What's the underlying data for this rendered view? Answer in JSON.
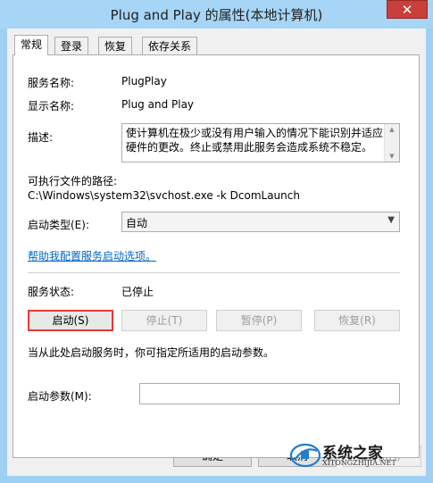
{
  "window": {
    "title": "Plug and Play 的属性(本地计算机)",
    "close_glyph": "✕"
  },
  "tabs": [
    {
      "label": "常规",
      "active": true
    },
    {
      "label": "登录",
      "active": false
    },
    {
      "label": "恢复",
      "active": false
    },
    {
      "label": "依存关系",
      "active": false
    }
  ],
  "general": {
    "service_name_label": "服务名称:",
    "service_name_value": "PlugPlay",
    "display_name_label": "显示名称:",
    "display_name_value": "Plug and Play",
    "description_label": "描述:",
    "description_value": "使计算机在极少或没有用户输入的情况下能识别并适应硬件的更改。终止或禁用此服务会造成系统不稳定。",
    "exe_path_label": "可执行文件的路径:",
    "exe_path_value": "C:\\Windows\\system32\\svchost.exe -k DcomLaunch",
    "startup_type_label": "启动类型(E):",
    "startup_type_value": "自动",
    "help_link": "帮助我配置服务启动选项。",
    "service_status_label": "服务状态:",
    "service_status_value": "已停止",
    "buttons": {
      "start": "启动(S)",
      "stop": "停止(T)",
      "pause": "暂停(P)",
      "resume": "恢复(R)"
    },
    "hint_text": "当从此处启动服务时，你可指定所适用的启动参数。",
    "start_params_label": "启动参数(M):",
    "start_params_value": ""
  },
  "footer": {
    "ok": "确定",
    "cancel": "取消",
    "apply": "应用(A)"
  },
  "watermark": {
    "title": "系统之家",
    "url": "XITONGZHIJIA.NET"
  }
}
